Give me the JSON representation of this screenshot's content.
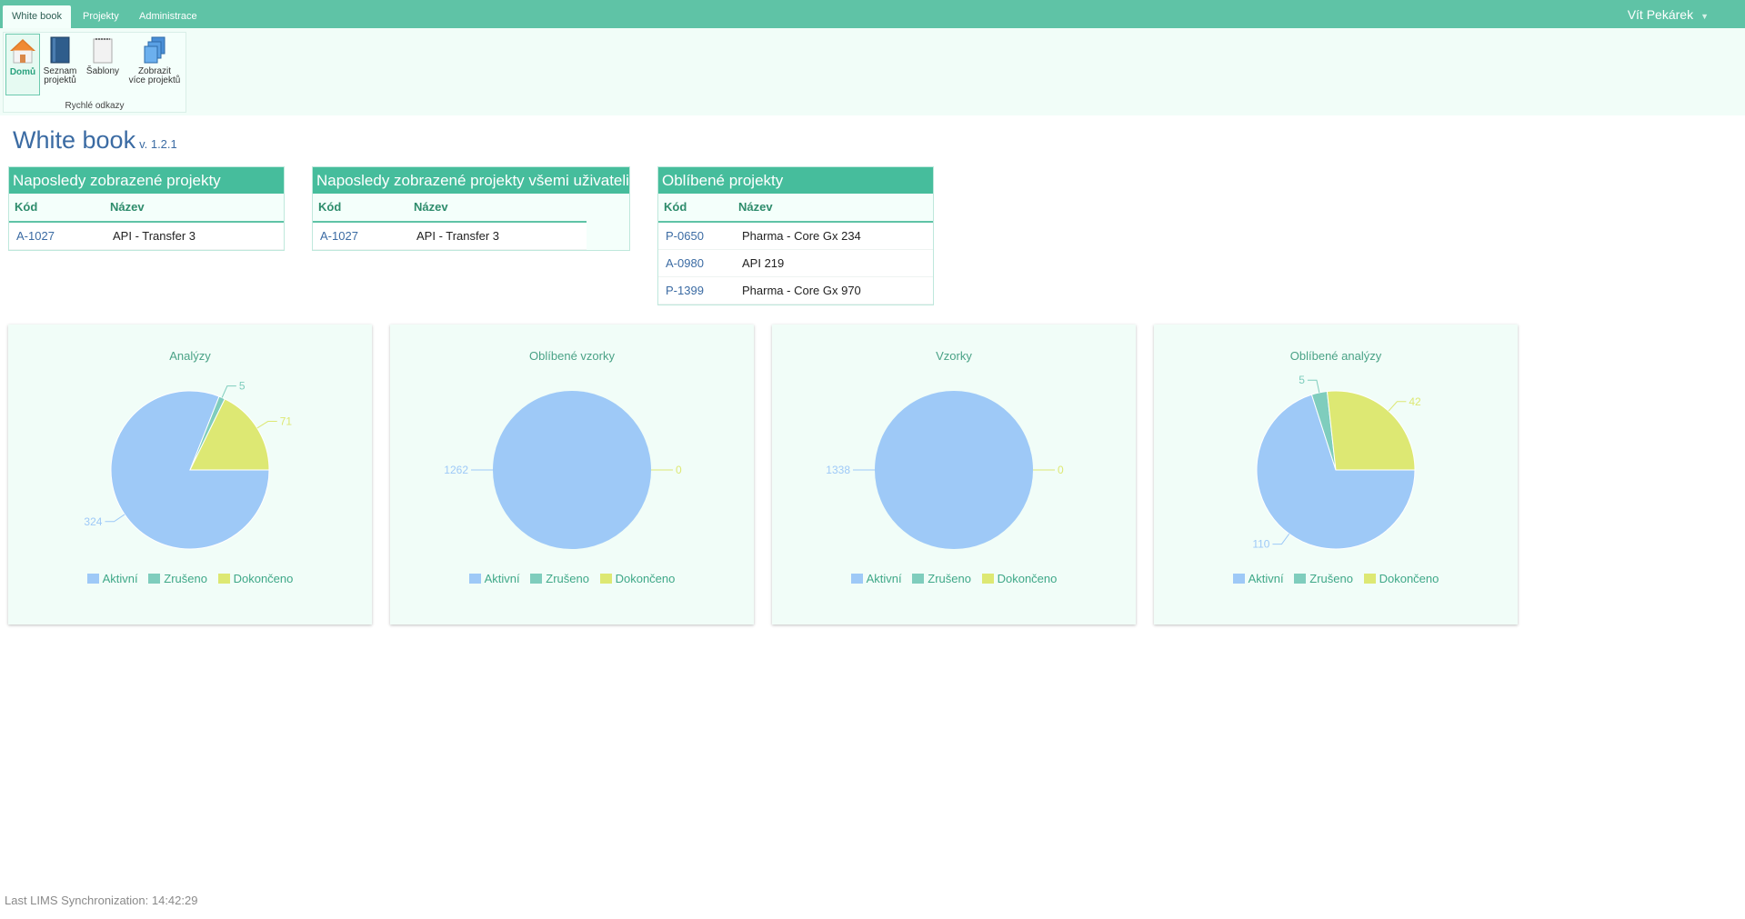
{
  "tabs": [
    {
      "label": "White book",
      "active": true
    },
    {
      "label": "Projekty",
      "active": false
    },
    {
      "label": "Administrace",
      "active": false
    }
  ],
  "user": {
    "name": "Vít Pekárek"
  },
  "ribbon": {
    "buttons": [
      {
        "label_line1": "Domů",
        "label_line2": "",
        "icon": "home-icon",
        "active": true
      },
      {
        "label_line1": "Seznam",
        "label_line2": "projektů",
        "icon": "book-icon",
        "active": false
      },
      {
        "label_line1": "Šablony",
        "label_line2": "",
        "icon": "notepad-icon",
        "active": false
      },
      {
        "label_line1": "Zobrazit",
        "label_line2": "více projektů",
        "icon": "multi-books-icon",
        "active": false
      }
    ],
    "group_label": "Rychlé odkazy"
  },
  "page": {
    "title": "White book",
    "version": "v. 1.2.1"
  },
  "tables": {
    "col_code": "Kód",
    "col_name": "Název",
    "recent": {
      "title": "Naposledy zobrazené projekty",
      "rows": [
        {
          "code": "A-1027",
          "name": "API - Transfer 3"
        }
      ]
    },
    "recent_all": {
      "title": "Naposledy zobrazené projekty všemi uživateli",
      "rows": [
        {
          "code": "A-1027",
          "name": "API - Transfer 3"
        }
      ]
    },
    "favorite": {
      "title": "Oblíbené projekty",
      "rows": [
        {
          "code": "P-0650",
          "name": "Pharma - Core Gx 234"
        },
        {
          "code": "A-0980",
          "name": "API 219"
        },
        {
          "code": "P-1399",
          "name": "Pharma - Core Gx 970"
        }
      ]
    }
  },
  "colors": {
    "aktivni": "#9ec9f7",
    "zruseno": "#7fcdbd",
    "dokonceno": "#dde873",
    "header": "#5fc3a6"
  },
  "chart_data": [
    {
      "type": "pie",
      "title": "Analýzy",
      "categories": [
        "Aktivní",
        "Zrušeno",
        "Dokončeno"
      ],
      "values": [
        324,
        5,
        71
      ],
      "legend": "bottom"
    },
    {
      "type": "pie",
      "title": "Oblíbené vzorky",
      "categories": [
        "Aktivní",
        "Zrušeno",
        "Dokončeno"
      ],
      "values": [
        1262,
        0,
        0
      ],
      "shown_labels": [
        "1262",
        "",
        "0"
      ],
      "legend": "bottom"
    },
    {
      "type": "pie",
      "title": "Vzorky",
      "categories": [
        "Aktivní",
        "Zrušeno",
        "Dokončeno"
      ],
      "values": [
        1338,
        0,
        0
      ],
      "shown_labels": [
        "1338",
        "",
        "0"
      ],
      "legend": "bottom"
    },
    {
      "type": "pie",
      "title": "Oblíbené analýzy",
      "categories": [
        "Aktivní",
        "Zrušeno",
        "Dokončeno"
      ],
      "values": [
        110,
        5,
        42
      ],
      "legend": "bottom"
    }
  ],
  "footer": {
    "sync": "Last LIMS Synchronization: 14:42:29"
  }
}
